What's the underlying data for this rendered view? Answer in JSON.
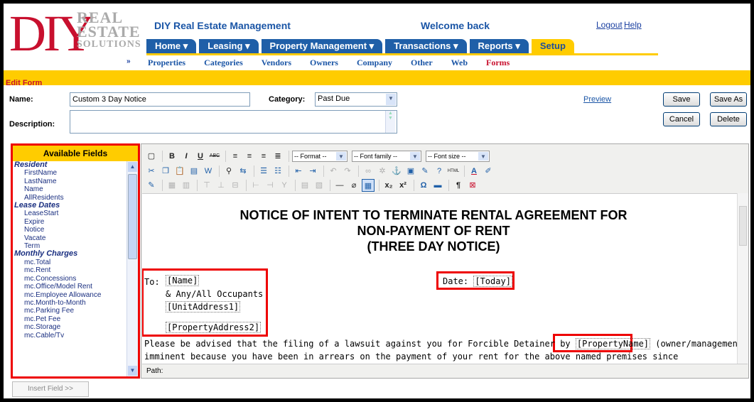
{
  "header": {
    "logo_main": "DIY",
    "logo_line1": "REAL",
    "logo_line2": "ESTATE",
    "logo_line3": "SOLUTIONS",
    "app_title": "DIY Real Estate Management",
    "welcome": "Welcome back",
    "logout": "Logout",
    "help": "Help"
  },
  "nav": {
    "tabs": [
      "Home ▾",
      "Leasing ▾",
      "Property Management ▾",
      "Transactions ▾",
      "Reports ▾",
      "Setup"
    ],
    "active_tab": "Setup"
  },
  "subnav": {
    "arrow": "»",
    "items": [
      "Properties",
      "Categories",
      "Vendors",
      "Owners",
      "Company",
      "Other",
      "Web",
      "Forms"
    ],
    "active": "Forms"
  },
  "form": {
    "section_title": "Edit Form",
    "name_label": "Name:",
    "name_value": "Custom 3 Day Notice",
    "category_label": "Category:",
    "category_value": "Past Due",
    "description_label": "Description:",
    "description_value": "",
    "preview": "Preview",
    "save": "Save",
    "save_as": "Save As",
    "cancel": "Cancel",
    "delete": "Delete"
  },
  "fields_panel": {
    "title": "Available Fields",
    "groups": [
      {
        "name": "Resident",
        "items": [
          "FirstName",
          "LastName",
          "Name",
          "AllResidents"
        ]
      },
      {
        "name": "Lease Dates",
        "items": [
          "LeaseStart",
          "Expire",
          "Notice",
          "Vacate",
          "Term"
        ]
      },
      {
        "name": "Monthly Charges",
        "items": [
          "mc.Total",
          "mc.Rent",
          "mc.Concessions",
          "mc.Office/Model Rent",
          "mc.Employee Allowance",
          "mc.Month-to-Month",
          "mc.Parking Fee",
          "mc.Pet Fee",
          "mc.Storage",
          "mc.Cable/Tv"
        ]
      }
    ],
    "insert_button": "Insert Field >>"
  },
  "toolbar": {
    "format": "-- Format --",
    "font_family": "-- Font family --",
    "font_size": "-- Font size --"
  },
  "document": {
    "heading1": "NOTICE OF INTENT TO TERMINATE RENTAL AGREEMENT FOR",
    "heading2": "NON-PAYMENT OF RENT",
    "heading3": "(THREE DAY NOTICE)",
    "to_label": "To:",
    "to_name": "[Name]",
    "occupants": "& Any/All Occupants",
    "unit_address": "[UnitAddress1]",
    "property_address": "[PropertyAddress2]",
    "date_label": "Date:",
    "date_value": "[Today]",
    "para_line1_a": "Please be advised that the filing of a lawsuit against you for Forcible Detainer by",
    "para_property": "[PropertyName]",
    "para_line1_b": "(owner/management) is",
    "para_line2": "imminent because you have been in arrears on the payment of your rent for the above named premises since"
  },
  "path_label": "Path:"
}
